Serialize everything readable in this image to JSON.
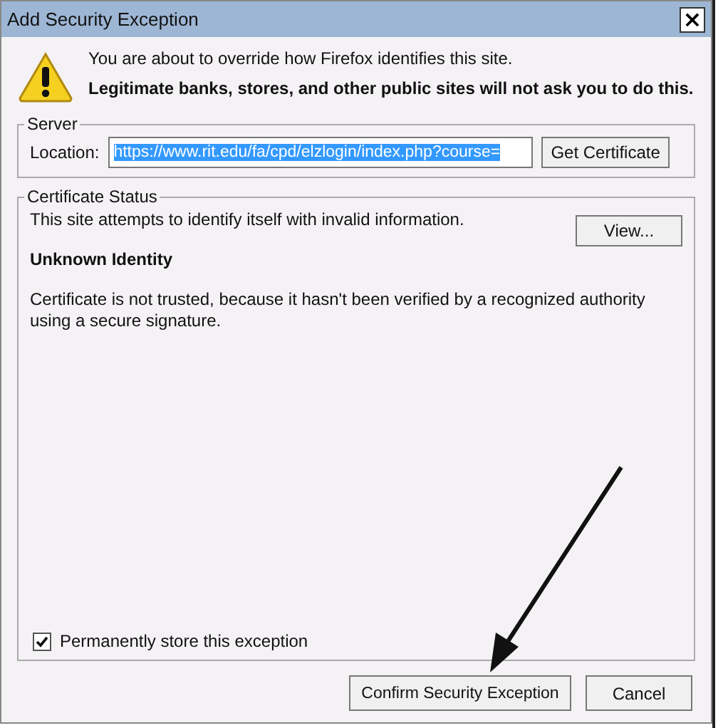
{
  "window": {
    "title": "Add Security Exception",
    "close_label": "×"
  },
  "warning": {
    "message": "You are about to override how Firefox identifies this site.",
    "emphasis": "Legitimate banks, stores, and other public sites will not ask you to do this."
  },
  "server": {
    "legend": "Server",
    "location_label": "Location:",
    "location_value": "https://www.rit.edu/fa/cpd/elzlogin/index.php?course=",
    "get_certificate_button": "Get Certificate"
  },
  "certificate_status": {
    "legend": "Certificate Status",
    "summary": "This site attempts to identify itself with invalid information.",
    "view_button": "View...",
    "heading": "Unknown Identity",
    "detail": "Certificate is not trusted, because it hasn't been verified by a recognized authority using a secure signature."
  },
  "permanent_store": {
    "label": "Permanently store this exception",
    "checked": true
  },
  "buttons": [
    {
      "label": "Confirm Security Exception"
    },
    {
      "label": "Cancel"
    }
  ]
}
